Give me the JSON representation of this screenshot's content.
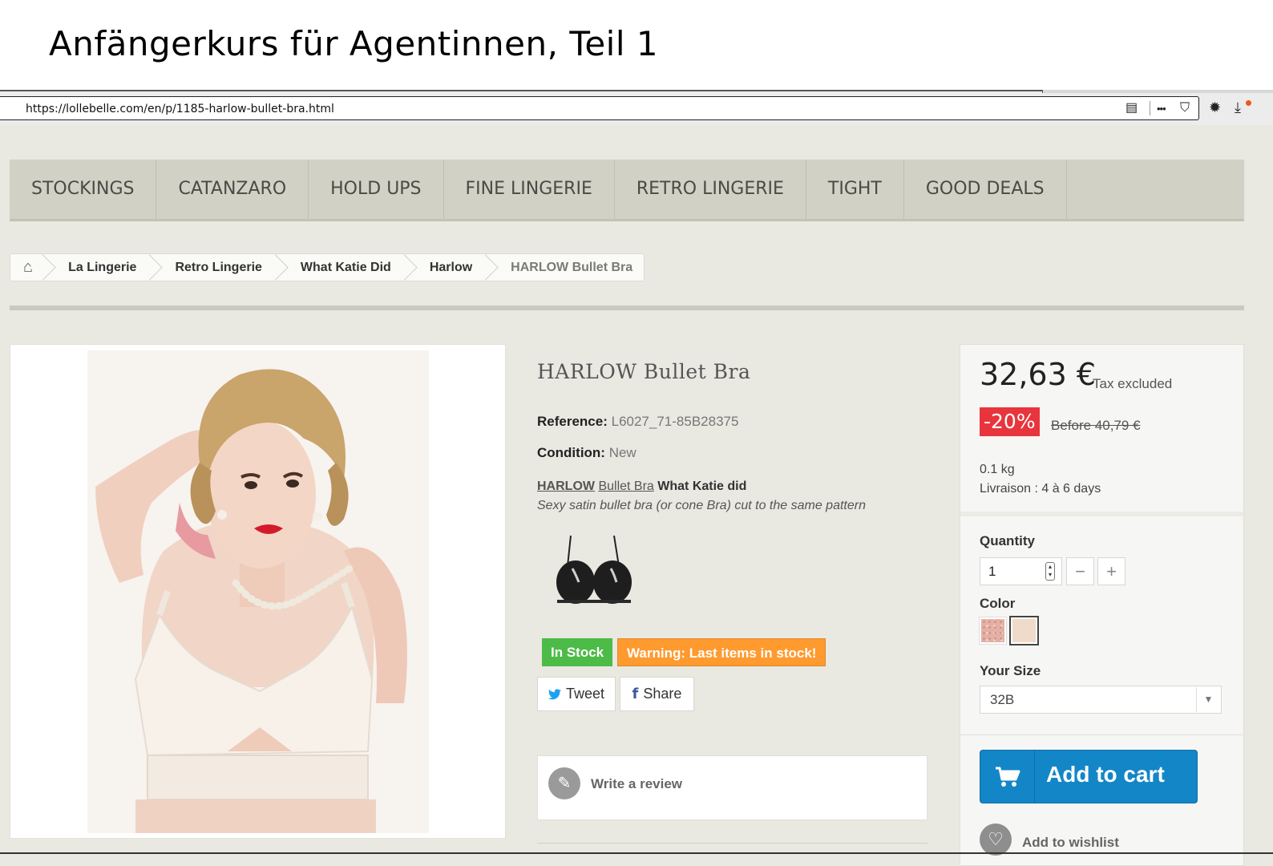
{
  "slide": {
    "title": "Anfängerkurs für Agentinnen, Teil 1"
  },
  "browser": {
    "url": "https://lollebelle.com/en/p/1185-harlow-bullet-bra.html",
    "icons": [
      "reader-view-icon",
      "more-actions-icon",
      "pocket-icon",
      "settings-icon",
      "downloads-icon"
    ],
    "glyphs": {
      "reader": "▤",
      "more": "•••",
      "pocket": "⛉",
      "gear": "✹",
      "download": "⤓"
    }
  },
  "nav": {
    "items": [
      "STOCKINGS",
      "CATANZARO",
      "HOLD UPS",
      "FINE LINGERIE",
      "RETRO LINGERIE",
      "TIGHT",
      "GOOD DEALS"
    ]
  },
  "breadcrumb": {
    "home_glyph": "⌂",
    "items": [
      "La Lingerie",
      "Retro Lingerie",
      "What Katie Did",
      "Harlow",
      "HARLOW Bullet Bra"
    ]
  },
  "product": {
    "title": "HARLOW Bullet Bra",
    "reference_label": "Reference:",
    "reference_value": "L6027_71-85B28375",
    "condition_label": "Condition:",
    "condition_value": "New",
    "desc_brand": "HARLOW",
    "desc_name": "Bullet Bra",
    "desc_maker": "What Katie did",
    "desc_text": "Sexy satin bullet bra (or cone Bra) cut to the same pattern",
    "in_stock": "In Stock",
    "warning": "Warning: Last items in stock!",
    "tweet": "Tweet",
    "share": "Share",
    "fb_glyph": "f",
    "review_label": "Write a review",
    "review_glyph": "✎"
  },
  "panel": {
    "price": "32,63 €",
    "tax": "Tax excluded",
    "discount": "-20%",
    "before": "Before 40,79 €",
    "weight": "0.1 kg",
    "delivery": "Livraison : 4 à 6 days",
    "quantity_label": "Quantity",
    "quantity_value": "1",
    "minus": "−",
    "plus": "+",
    "color_label": "Color",
    "size_label": "Your Size",
    "size_value": "32B",
    "add_to_cart": "Add to cart",
    "add_to_wishlist": "Add to wishlist",
    "wish_glyph": "♡"
  },
  "colors": {
    "accent_blue": "#1386c7",
    "discount_red": "#e8343c",
    "stock_green": "#4cbb47",
    "warning_orange": "#ff9a2e",
    "twitter": "#1da1f2",
    "facebook": "#3b5998"
  }
}
